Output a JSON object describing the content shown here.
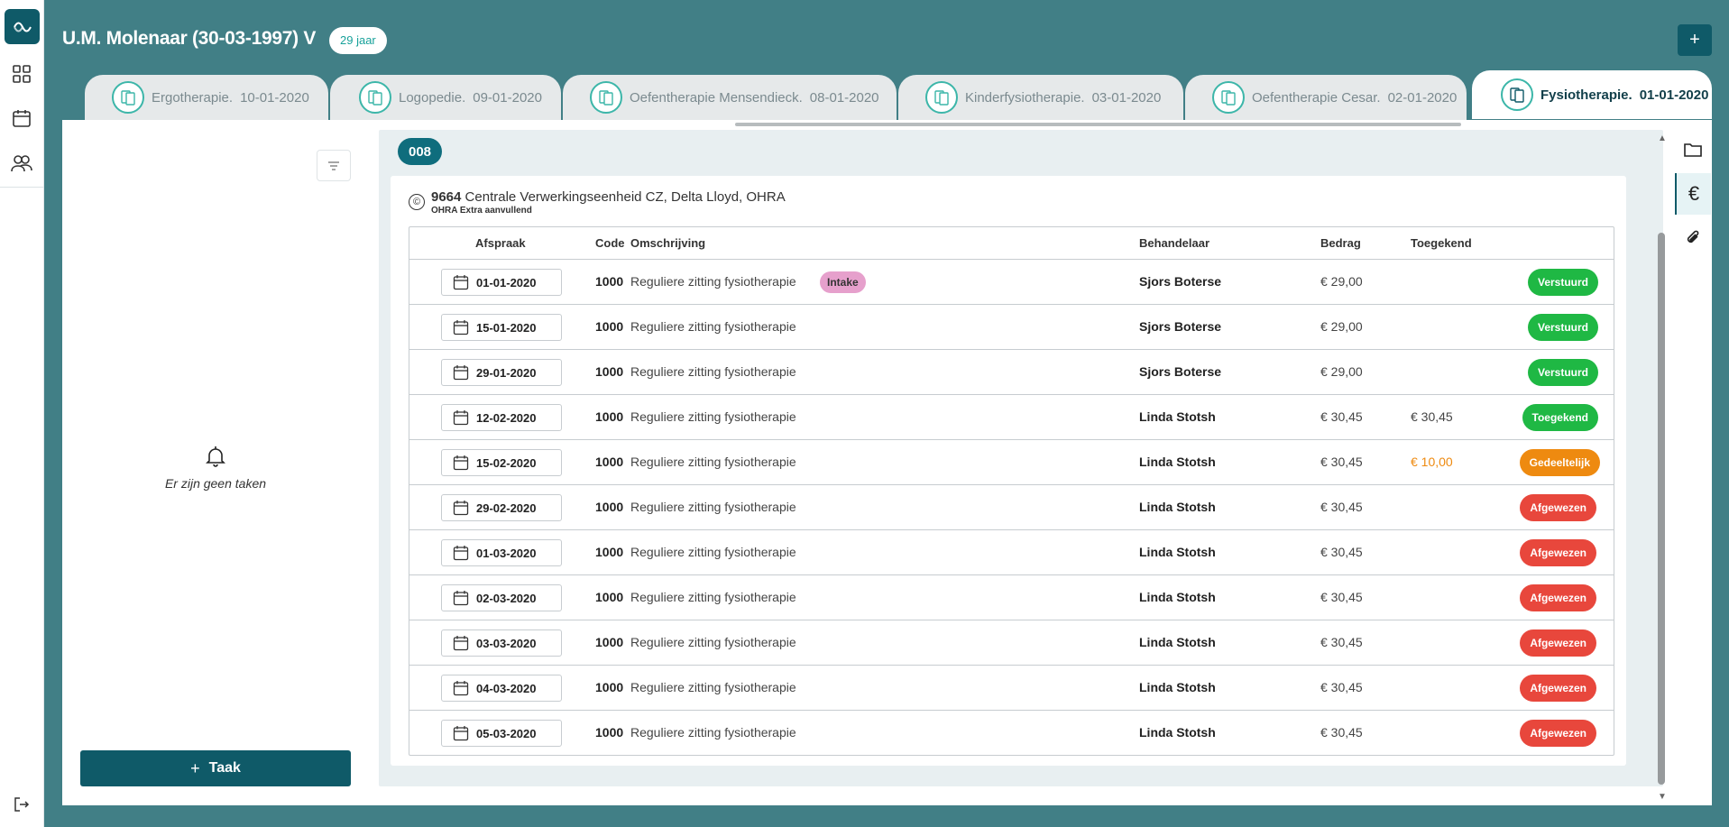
{
  "patient": {
    "title": "U.M. Molenaar (30-03-1997) V",
    "age": "29 jaar"
  },
  "tabs": [
    {
      "name": "Ergotherapie.",
      "date": "10-01-2020",
      "active": false
    },
    {
      "name": "Logopedie.",
      "date": "09-01-2020",
      "active": false
    },
    {
      "name": "Oefentherapie Mensendieck.",
      "date": "08-01-2020",
      "active": false
    },
    {
      "name": "Kinderfysiotherapie.",
      "date": "03-01-2020",
      "active": false
    },
    {
      "name": "Oefentherapie Cesar.",
      "date": "02-01-2020",
      "active": false
    },
    {
      "name": "Fysiotherapie.",
      "date": "01-01-2020",
      "active": true
    }
  ],
  "tasks": {
    "empty_text": "Er zijn geen taken",
    "add_button": "Taak"
  },
  "invoice": {
    "number": "008",
    "insurer_code": "9664",
    "insurer_name": "Centrale Verwerkingseenheid CZ, Delta Lloyd, OHRA",
    "insurer_plan": "OHRA Extra aanvullend",
    "columns": {
      "afspraak": "Afspraak",
      "code": "Code",
      "omschrijving": "Omschrijving",
      "behandelaar": "Behandelaar",
      "bedrag": "Bedrag",
      "toegekend": "Toegekend"
    },
    "rows": [
      {
        "date": "01-01-2020",
        "code": "1000",
        "desc": "Reguliere zitting fysiotherapie",
        "tag": "Intake",
        "behandelaar": "Sjors Boterse",
        "bedrag": "€ 29,00",
        "toegekend": "",
        "status": "Verstuurd",
        "status_type": "sent"
      },
      {
        "date": "15-01-2020",
        "code": "1000",
        "desc": "Reguliere zitting fysiotherapie",
        "tag": "",
        "behandelaar": "Sjors Boterse",
        "bedrag": "€ 29,00",
        "toegekend": "",
        "status": "Verstuurd",
        "status_type": "sent"
      },
      {
        "date": "29-01-2020",
        "code": "1000",
        "desc": "Reguliere zitting fysiotherapie",
        "tag": "",
        "behandelaar": "Sjors Boterse",
        "bedrag": "€ 29,00",
        "toegekend": "",
        "status": "Verstuurd",
        "status_type": "sent"
      },
      {
        "date": "12-02-2020",
        "code": "1000",
        "desc": "Reguliere zitting fysiotherapie",
        "tag": "",
        "behandelaar": "Linda Stotsh",
        "bedrag": "€ 30,45",
        "toegekend": "€ 30,45",
        "status": "Toegekend",
        "status_type": "granted"
      },
      {
        "date": "15-02-2020",
        "code": "1000",
        "desc": "Reguliere zitting fysiotherapie",
        "tag": "",
        "behandelaar": "Linda Stotsh",
        "bedrag": "€ 30,45",
        "toegekend": "€ 10,00",
        "status": "Gedeeltelijk",
        "status_type": "partial"
      },
      {
        "date": "29-02-2020",
        "code": "1000",
        "desc": "Reguliere zitting fysiotherapie",
        "tag": "",
        "behandelaar": "Linda Stotsh",
        "bedrag": "€ 30,45",
        "toegekend": "",
        "status": "Afgewezen",
        "status_type": "rejected"
      },
      {
        "date": "01-03-2020",
        "code": "1000",
        "desc": "Reguliere zitting fysiotherapie",
        "tag": "",
        "behandelaar": "Linda Stotsh",
        "bedrag": "€ 30,45",
        "toegekend": "",
        "status": "Afgewezen",
        "status_type": "rejected"
      },
      {
        "date": "02-03-2020",
        "code": "1000",
        "desc": "Reguliere zitting fysiotherapie",
        "tag": "",
        "behandelaar": "Linda Stotsh",
        "bedrag": "€ 30,45",
        "toegekend": "",
        "status": "Afgewezen",
        "status_type": "rejected"
      },
      {
        "date": "03-03-2020",
        "code": "1000",
        "desc": "Reguliere zitting fysiotherapie",
        "tag": "",
        "behandelaar": "Linda Stotsh",
        "bedrag": "€ 30,45",
        "toegekend": "",
        "status": "Afgewezen",
        "status_type": "rejected"
      },
      {
        "date": "04-03-2020",
        "code": "1000",
        "desc": "Reguliere zitting fysiotherapie",
        "tag": "",
        "behandelaar": "Linda Stotsh",
        "bedrag": "€ 30,45",
        "toegekend": "",
        "status": "Afgewezen",
        "status_type": "rejected"
      },
      {
        "date": "05-03-2020",
        "code": "1000",
        "desc": "Reguliere zitting fysiotherapie",
        "tag": "",
        "behandelaar": "Linda Stotsh",
        "bedrag": "€ 30,45",
        "toegekend": "",
        "status": "Afgewezen",
        "status_type": "rejected"
      }
    ]
  },
  "colors": {
    "background": "#417f86",
    "primary": "#0f5a68",
    "accent_teal": "#3cb6a9",
    "status_sent": "#1fb844",
    "status_granted": "#1fb844",
    "status_partial": "#ee8a10",
    "status_rejected": "#e8473c",
    "tag_intake": "#e6a0cc"
  },
  "icons": {
    "rail": [
      "app-logo-icon",
      "dashboard-grid-icon",
      "calendar-icon",
      "users-icon",
      "logout-icon"
    ],
    "side": [
      "folder-icon",
      "euro-icon",
      "paperclip-icon"
    ]
  }
}
